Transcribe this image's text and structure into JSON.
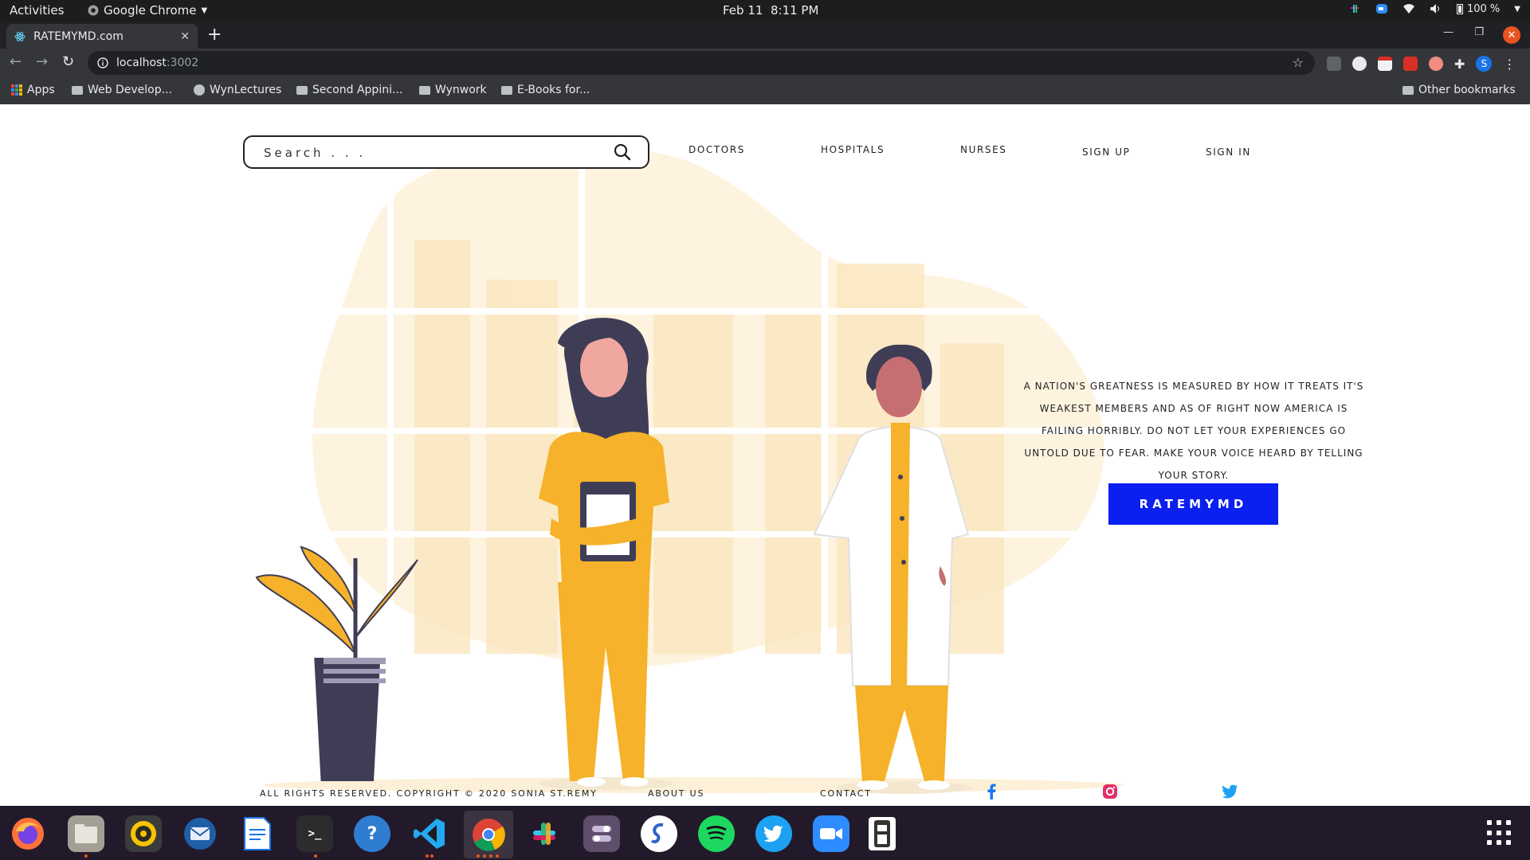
{
  "system_bar": {
    "activities": "Activities",
    "app_name": "Google Chrome",
    "date": "Feb 11",
    "time": "8:11 PM",
    "battery": "100 %"
  },
  "browser": {
    "tab_title": "RATEMYMD.com",
    "url_host": "localhost",
    "url_port": ":3002",
    "bookmarks": [
      "Apps",
      "Web Develop...",
      "WynLectures",
      "Second Appini...",
      "Wynwork",
      "E-Books for..."
    ],
    "other_bookmarks": "Other bookmarks",
    "profile_initial": "S"
  },
  "page": {
    "search_placeholder": "Search . . .",
    "nav": [
      "DOCTORS",
      "HOSPITALS",
      "NURSES",
      "SIGN UP",
      "SIGN IN"
    ],
    "tagline": "A NATION'S GREATNESS IS MEASURED BY HOW IT TREATS IT'S WEAKEST MEMBERS AND AS OF RIGHT NOW AMERICA IS FAILING HORRIBLY. DO NOT LET YOUR EXPERIENCES GO UNTOLD DUE TO FEAR. MAKE YOUR VOICE HEARD BY TELLING YOUR STORY.",
    "cta_label": "RATEMYMD",
    "footer": {
      "copyright": "ALL RIGHTS RESERVED. COPYRIGHT © 2020 SONIA ST.REMY",
      "about": "ABOUT US",
      "contact": "CONTACT"
    },
    "social_icons": [
      "facebook-icon",
      "instagram-icon",
      "twitter-icon"
    ],
    "colors": {
      "accent_button": "#0a1ff0",
      "illustration_yellow": "#f5b22a",
      "illustration_bg": "#fdf3df"
    }
  },
  "dock": {
    "apps": [
      "firefox",
      "files",
      "rhythmbox",
      "thunderbird",
      "writer",
      "terminal",
      "help",
      "vscode",
      "chrome",
      "slack",
      "tweaks",
      "simplenote",
      "spotify",
      "twitter",
      "zoom",
      "usb-creator"
    ]
  }
}
